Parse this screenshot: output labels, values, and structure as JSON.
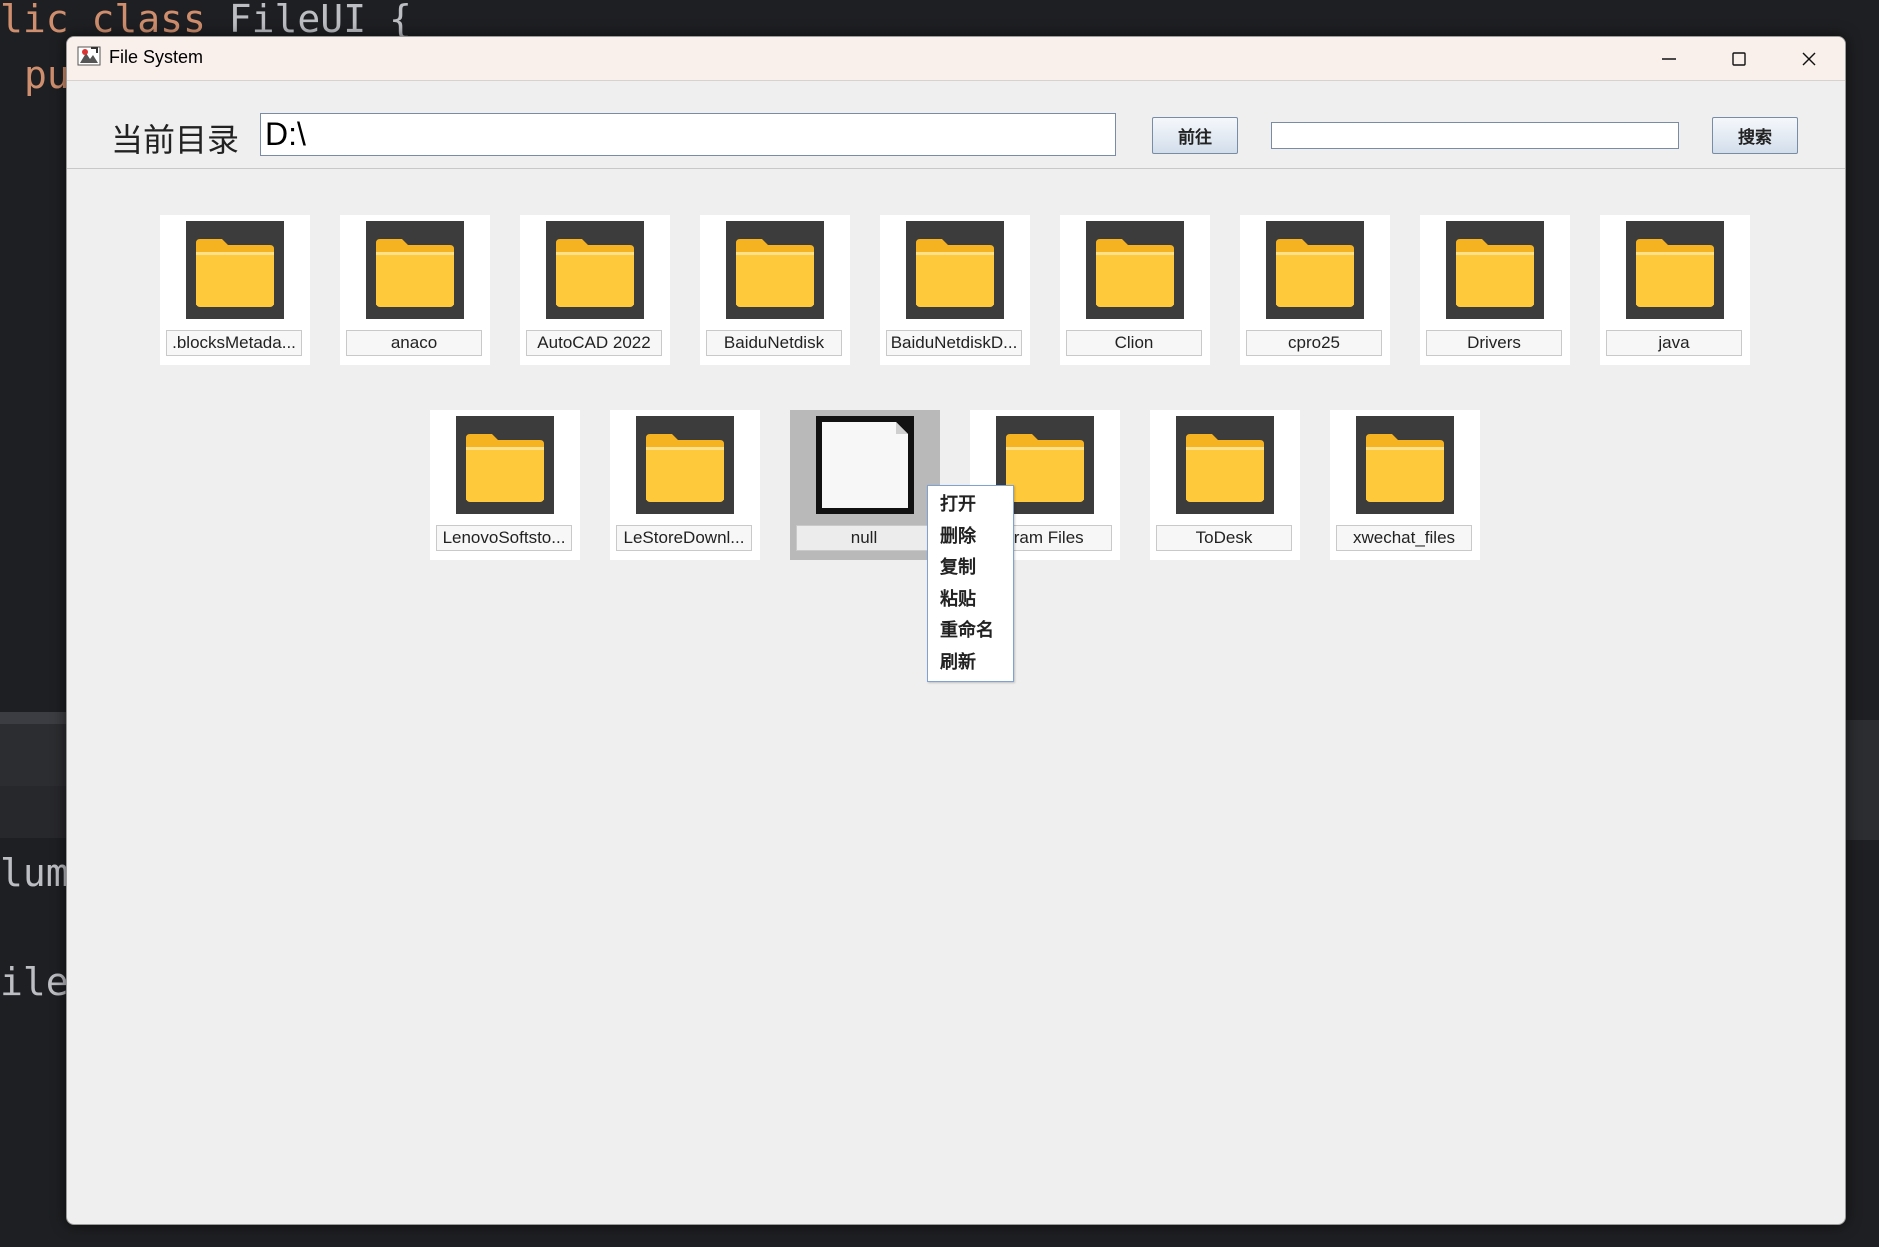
{
  "background_editor": {
    "line1": "lic class FileUI {",
    "line1_kw1": "lic",
    "line1_kw2": "class",
    "line1_rest": " FileUI {",
    "line2": "pu",
    "line3": "lum",
    "line4": "ile"
  },
  "window": {
    "title": "File System",
    "minimize_icon": "minimize-icon",
    "maximize_icon": "maximize-icon",
    "close_icon": "close-icon"
  },
  "toolbar": {
    "dir_label": "当前目录",
    "dir_value": "D:\\",
    "go_label": "前往",
    "search_value": "",
    "search_label": "搜索"
  },
  "files": [
    {
      "name": ".blocksMetada...",
      "type": "folder"
    },
    {
      "name": "anaco",
      "type": "folder"
    },
    {
      "name": "AutoCAD 2022",
      "type": "folder"
    },
    {
      "name": "BaiduNetdisk",
      "type": "folder"
    },
    {
      "name": "BaiduNetdiskD...",
      "type": "folder"
    },
    {
      "name": "Clion",
      "type": "folder"
    },
    {
      "name": "cpro25",
      "type": "folder"
    },
    {
      "name": "Drivers",
      "type": "folder"
    },
    {
      "name": "java",
      "type": "folder"
    },
    {
      "name": "LenovoSoftsto...",
      "type": "folder"
    },
    {
      "name": "LeStoreDownl...",
      "type": "folder"
    },
    {
      "name": "null",
      "type": "file",
      "selected": true
    },
    {
      "name": "gram Files",
      "type": "folder"
    },
    {
      "name": "ToDesk",
      "type": "folder"
    },
    {
      "name": "xwechat_files",
      "type": "folder"
    }
  ],
  "context_menu": {
    "items": [
      "打开",
      "删除",
      "复制",
      "粘贴",
      "重命名",
      "刷新"
    ]
  },
  "colors": {
    "folder": "#ffc93c",
    "folder_tab": "#f5b221",
    "icon_bg": "#3c3c3c",
    "selection": "#b9b9b9",
    "menu_border": "#7fa2d0"
  }
}
